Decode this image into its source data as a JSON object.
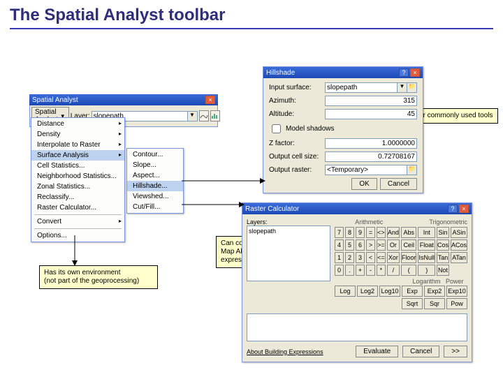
{
  "title": "The Spatial Analyst toolbar",
  "callouts": {
    "c1": "Dialogs for commonly used tools",
    "c2": "Can compose Map Algebra expressions",
    "c3_l1": "Has its own environment",
    "c3_l2": "(not part of the geoprocessing)"
  },
  "toolbar": {
    "title": "Spatial Analyst",
    "menu_label": "Spatial Analyst",
    "layer_label": "Layer:",
    "layer_value": "slopepath"
  },
  "menu1": {
    "items": [
      "Distance",
      "Density",
      "Interpolate to Raster",
      "Surface Analysis",
      "Cell Statistics...",
      "Neighborhood Statistics...",
      "Zonal Statistics...",
      "Reclassify...",
      "Raster Calculator...",
      "Convert",
      "Options..."
    ],
    "selected_index": 3
  },
  "menu2": {
    "items": [
      "Contour...",
      "Slope...",
      "Aspect...",
      "Hillshade...",
      "Viewshed...",
      "Cut/Fill..."
    ],
    "selected_index": 3
  },
  "hillshade": {
    "title": "Hillshade",
    "rows": {
      "input_surface": {
        "label": "Input surface:",
        "value": "slopepath"
      },
      "azimuth": {
        "label": "Azimuth:",
        "value": "315"
      },
      "altitude": {
        "label": "Altitude:",
        "value": "45"
      },
      "model_shadows": {
        "label": "Model shadows",
        "checked": false
      },
      "zfactor": {
        "label": "Z factor:",
        "value": "1.0000000"
      },
      "cellsize": {
        "label": "Output cell size:",
        "value": "0.72708167"
      },
      "outraster": {
        "label": "Output raster:",
        "value": "<Temporary>"
      }
    },
    "ok": "OK",
    "cancel": "Cancel"
  },
  "calc": {
    "title": "Raster Calculator",
    "layers_label": "Layers:",
    "layer_item": "slopepath",
    "groups": {
      "arith": "Arithmetic",
      "trig": "Trigonometric",
      "log": "Logarithm",
      "pow": "Power"
    },
    "keys_row1": [
      "7",
      "8",
      "9",
      "=",
      "<>",
      "And",
      "Abs",
      "Int",
      "Sin",
      "ASin"
    ],
    "keys_row2": [
      "4",
      "5",
      "6",
      ">",
      ">=",
      "Or",
      "Ceil",
      "Float",
      "Cos",
      "ACos"
    ],
    "keys_row3": [
      "1",
      "2",
      "3",
      "<",
      "<=",
      "Xor",
      "Floor",
      "IsNull",
      "Tan",
      "ATan"
    ],
    "keys_row4": [
      "0",
      ".",
      "+",
      "-",
      "*",
      "/",
      "(",
      ")",
      "Not",
      ""
    ],
    "log_keys": [
      "Log",
      "Log2",
      "Log10"
    ],
    "pow_keys": [
      "Exp",
      "Exp2",
      "Exp10",
      "Sqrt",
      "Sqr",
      "Pow"
    ],
    "about": "About Building Expressions",
    "evaluate": "Evaluate",
    "cancel": "Cancel",
    "more": ">>"
  }
}
